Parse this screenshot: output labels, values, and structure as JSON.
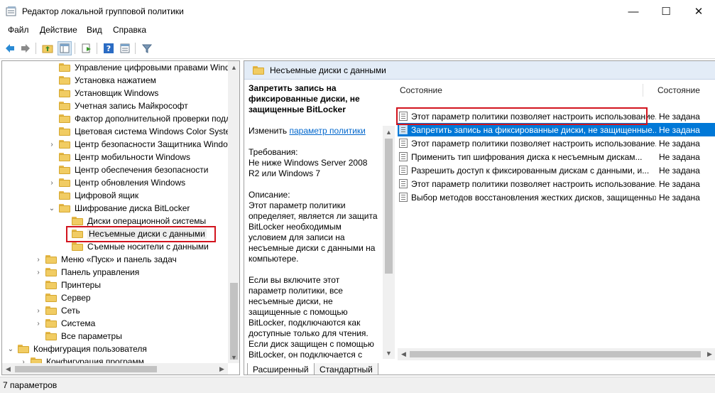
{
  "window": {
    "title": "Редактор локальной групповой политики",
    "minimize": "—",
    "maximize": "☐",
    "close": "✕"
  },
  "menu": [
    "Файл",
    "Действие",
    "Вид",
    "Справка"
  ],
  "toolbar": {
    "buttons": [
      "back-icon",
      "forward-icon",
      "up-folder-icon",
      "show-hide-tree-icon",
      "export-list-icon",
      "help-icon",
      "properties-icon",
      "filter-icon"
    ]
  },
  "tree": [
    {
      "label": "Управление цифровыми правами Windows",
      "expander": "",
      "level": 4
    },
    {
      "label": "Установка нажатием",
      "expander": "",
      "level": 4
    },
    {
      "label": "Установщик Windows",
      "expander": "",
      "level": 4
    },
    {
      "label": "Учетная запись Майкрософт",
      "expander": "",
      "level": 4
    },
    {
      "label": "Фактор дополнительной проверки подлинности",
      "expander": "",
      "level": 4
    },
    {
      "label": "Цветовая система Windows Color System",
      "expander": "",
      "level": 4
    },
    {
      "label": "Центр безопасности Защитника Windows",
      "expander": "›",
      "level": 4
    },
    {
      "label": "Центр мобильности Windows",
      "expander": "",
      "level": 4
    },
    {
      "label": "Центр обеспечения безопасности",
      "expander": "",
      "level": 4
    },
    {
      "label": "Центр обновления Windows",
      "expander": "›",
      "level": 4
    },
    {
      "label": "Цифровой ящик",
      "expander": "",
      "level": 4
    },
    {
      "label": "Шифрование диска BitLocker",
      "expander": "⌄",
      "level": 4
    },
    {
      "label": "Диски операционной системы",
      "expander": "",
      "level": 5
    },
    {
      "label": "Несъемные диски с данными",
      "expander": "",
      "level": 5,
      "selected": true
    },
    {
      "label": "Съемные носители с данными",
      "expander": "",
      "level": 5
    },
    {
      "label": "Меню «Пуск» и панель задач",
      "expander": "›",
      "level": 3
    },
    {
      "label": "Панель управления",
      "expander": "›",
      "level": 3
    },
    {
      "label": "Принтеры",
      "expander": "",
      "level": 3
    },
    {
      "label": "Сервер",
      "expander": "",
      "level": 3
    },
    {
      "label": "Сеть",
      "expander": "›",
      "level": 3
    },
    {
      "label": "Система",
      "expander": "›",
      "level": 3
    },
    {
      "label": "Все параметры",
      "expander": "",
      "level": 3
    },
    {
      "label": "Конфигурация пользователя",
      "expander": "⌄",
      "level": 1
    },
    {
      "label": "Конфигурация программ",
      "expander": "›",
      "level": 2
    }
  ],
  "right": {
    "header": "Несъемные диски с данными",
    "description": {
      "title": "Запретить запись на фиксированные диски, не защищенные BitLocker",
      "edit_prefix": "Изменить",
      "edit_link": "параметр политики",
      "requirements": "Требования:\nНе ниже Windows Server 2008 R2 или Windows 7",
      "description_label": "Описание:",
      "description_text": "Этот параметр политики определяет, является ли защита BitLocker необходимым условием для записи на несъемные диски с данными на компьютере.",
      "description_more": "Если вы включите этот параметр политики, все несъемные диски, не защищенные с помощью BitLocker, подключаются как доступные только для чтения. Если диск защищен с помощью BitLocker, он подключается с"
    },
    "columns": [
      "Состояние",
      "Состояние"
    ],
    "rows": [
      {
        "name": "Этот параметр политики позволяет настроить использование...",
        "state": "Не задана"
      },
      {
        "name": "Запретить запись на фиксированные диски, не защищенные...",
        "state": "Не задана",
        "selected": true
      },
      {
        "name": "Этот параметр политики позволяет настроить использование...",
        "state": "Не задана"
      },
      {
        "name": "Применить тип шифрования диска к несъемным дискам...",
        "state": "Не задана"
      },
      {
        "name": "Разрешить доступ к фиксированным дискам с данными, и...",
        "state": "Не задана"
      },
      {
        "name": "Этот параметр политики позволяет настроить использование...",
        "state": "Не задана"
      },
      {
        "name": "Выбор методов восстановления жестких дисков, защищенных...",
        "state": "Не задана"
      }
    ],
    "tabs": [
      "Расширенный",
      "Стандартный"
    ]
  },
  "status": "7 параметров"
}
